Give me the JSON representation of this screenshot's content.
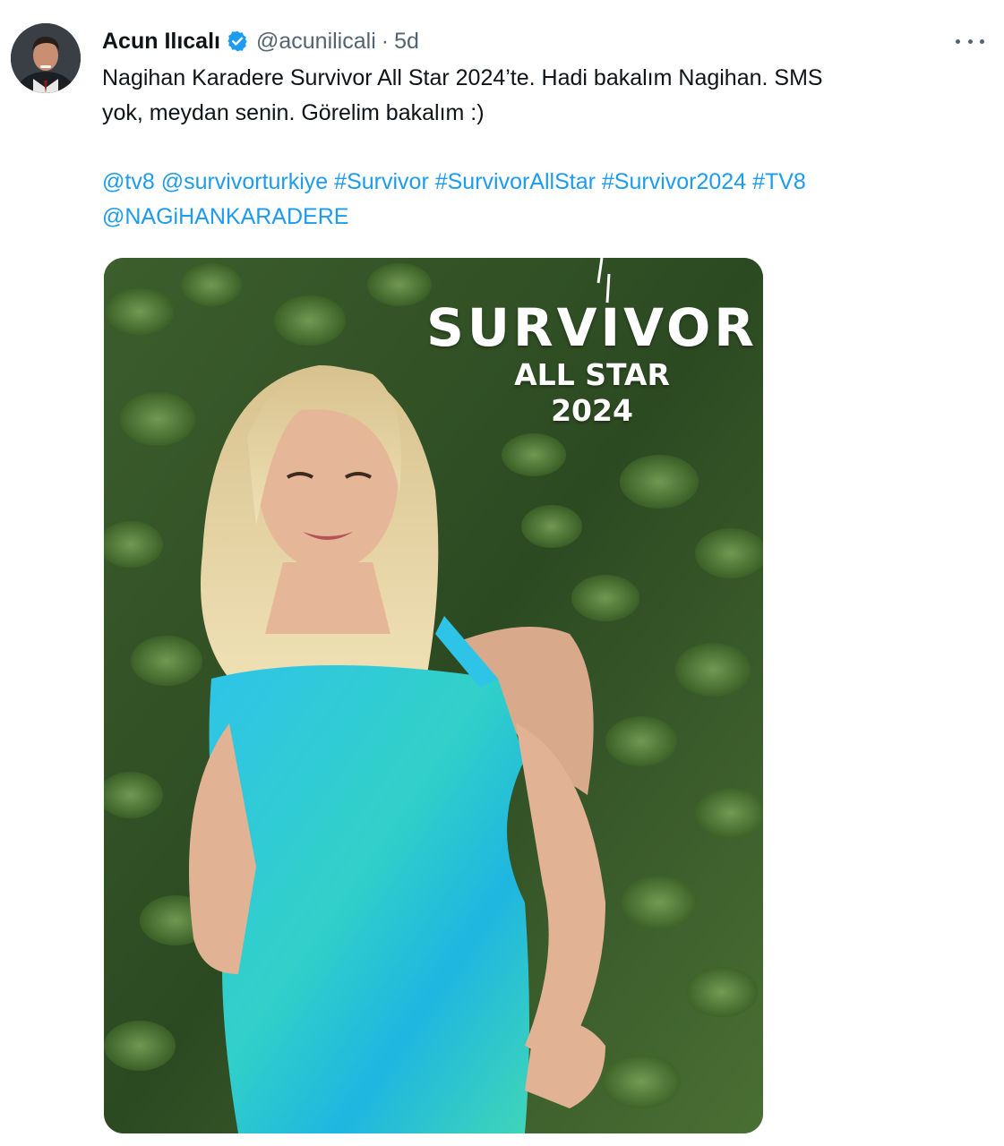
{
  "tweet": {
    "author": {
      "display_name": "Acun Ilıcalı",
      "handle": "@acunilicali",
      "verified": true
    },
    "separator": "·",
    "time": "5d",
    "text_line1": "Nagihan Karadere Survivor All Star 2024’te. Hadi bakalım Nagihan. SMS",
    "text_line2": "yok, meydan senin. Görelim bakalım :)",
    "tags": [
      "@tv8",
      "@survivorturkiye",
      "#Survivor",
      "#SurvivorAllStar",
      "#Survivor2024",
      "#TV8",
      "@NAGiHANKARADERE"
    ],
    "media": {
      "logo_title": "SURVIVOR",
      "logo_subtitle": "ALL STAR",
      "logo_year": "2024"
    }
  },
  "colors": {
    "link": "#1d9bf0",
    "text": "#0f1419",
    "secondary": "#536471",
    "verified_badge": "#1d9bf0"
  },
  "icons": {
    "verified": "verified-badge-icon",
    "more": "more-horizontal-icon"
  }
}
